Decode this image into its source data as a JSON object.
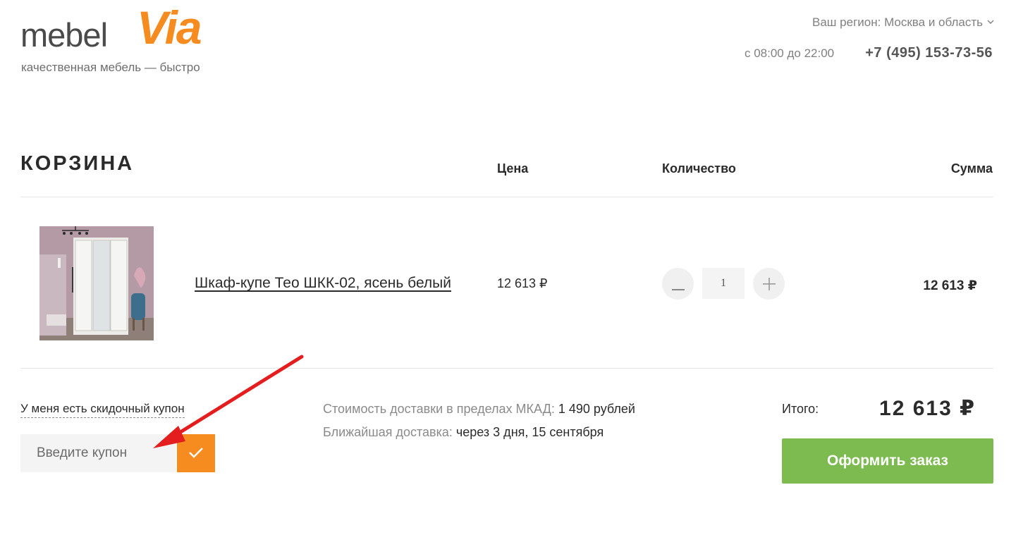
{
  "header": {
    "logo": {
      "word": "mebel",
      "accent": "Via",
      "tagline": "качественная мебель — быстро"
    },
    "region_text": "Ваш регион: Москва и область",
    "region_chevron_icon": "chevron-down-icon",
    "hours": "с 08:00 до 22:00",
    "phone": "+7 (495) 153-73-56"
  },
  "cart": {
    "title": "КОРЗИНА",
    "columns": {
      "price": "Цена",
      "quantity": "Количество",
      "sum": "Сумма"
    },
    "items": [
      {
        "name": "Шкаф-купе Тео ШКК-02, ясень белый",
        "price": "12 613 ₽",
        "quantity": "1",
        "sum": "12 613 ₽"
      }
    ]
  },
  "coupon": {
    "toggle_label": "У меня есть скидочный купон",
    "placeholder": "Введите купон",
    "apply_icon": "check-icon"
  },
  "delivery": {
    "cost_label": "Стоимость доставки в пределах МКАД:",
    "cost_value": "1 490 рублей",
    "nearest_label": "Ближайшая доставка:",
    "nearest_value": "через 3 дня, 15 сентября"
  },
  "totals": {
    "label": "Итого:",
    "value": "12 613 ₽",
    "checkout_label": "Оформить заказ"
  },
  "colors": {
    "brand_orange": "#f68b1f",
    "checkout_green": "#7dba4f",
    "annotation_arrow": "#e41e1e"
  }
}
